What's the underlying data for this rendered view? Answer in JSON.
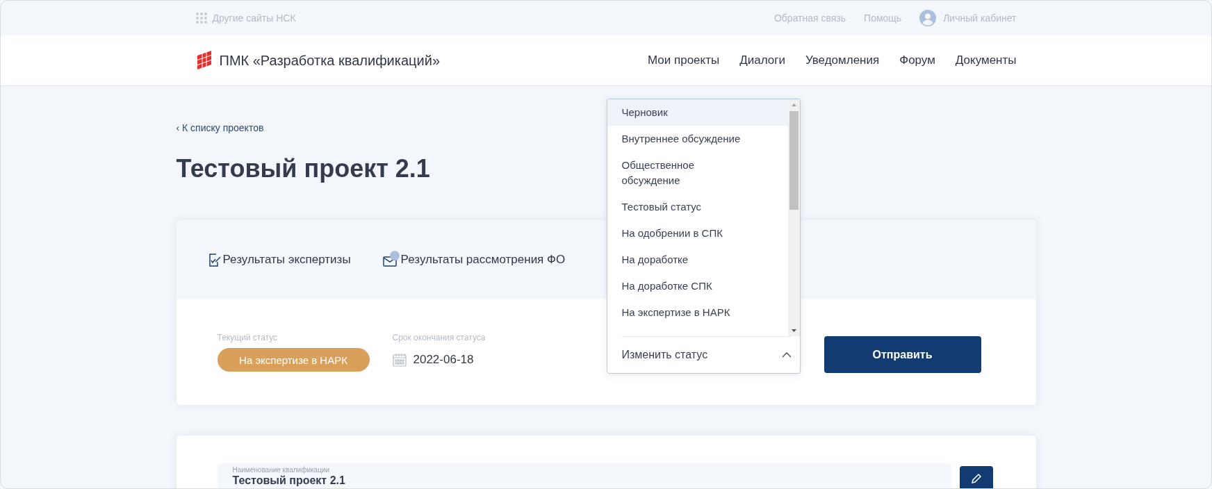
{
  "top_bar": {
    "other_sites": "Другие сайты НСК",
    "links": [
      "Обратная связь",
      "Помощь"
    ],
    "account": "Личный кабинет"
  },
  "header": {
    "logo_text": "ПМК «Разработка квалификаций»",
    "nav": [
      "Мои проекты",
      "Диалоги",
      "Уведомления",
      "Форум",
      "Документы"
    ]
  },
  "back_link": {
    "chevron": "‹",
    "label": "К списку проектов"
  },
  "title": "Тестовый проект 2.1",
  "result_tabs": [
    {
      "kind": "expertise",
      "label": "Результаты экспертизы",
      "unread": false
    },
    {
      "kind": "mail",
      "label": "Результаты рассмотрения ФО",
      "unread": true
    }
  ],
  "status_card": {
    "current_label": "Текущий статус",
    "current_status": "На экспертизе в НАРК",
    "deadline_label": "Срок окончания статуса",
    "deadline": "2022-06-18",
    "status_select": {
      "label": "Изменить статус",
      "expanded": true,
      "options": [
        {
          "label": "Черновик",
          "selected": true
        },
        {
          "label": "Внутреннее обсуждение",
          "selected": false
        },
        {
          "label": "Общественное обсуждение",
          "selected": false
        },
        {
          "label": "Тестовый статус",
          "selected": false
        },
        {
          "label": "На одобрении в СПК",
          "selected": false
        },
        {
          "label": "На доработке",
          "selected": false
        },
        {
          "label": "На доработке СПК",
          "selected": false
        },
        {
          "label": "На экспертизе в НАРК",
          "selected": false
        }
      ]
    },
    "submit": "Отправить"
  },
  "qualification": {
    "name_label": "Наименование квалификации",
    "name_value": "Тестовый проект 2.1"
  }
}
